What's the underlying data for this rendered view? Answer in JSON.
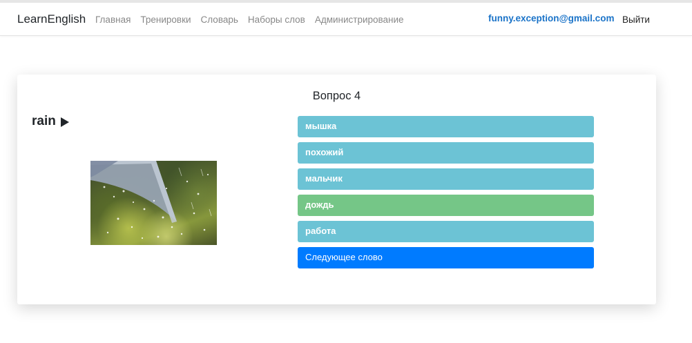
{
  "navbar": {
    "brand": "LearnEnglish",
    "links": [
      "Главная",
      "Тренировки",
      "Словарь",
      "Наборы слов",
      "Администрирование"
    ],
    "user_email": "funny.exception@gmail.com",
    "logout_label": "Выйти"
  },
  "quiz": {
    "question_title": "Вопрос 4",
    "word": "rain",
    "options": [
      {
        "label": "мышка",
        "state": "info"
      },
      {
        "label": "похожий",
        "state": "info"
      },
      {
        "label": "мальчик",
        "state": "info"
      },
      {
        "label": "дождь",
        "state": "correct"
      },
      {
        "label": "работа",
        "state": "info"
      }
    ],
    "next_label": "Следующее слово"
  },
  "colors": {
    "option": "#6cc3d5",
    "correct": "#75c687",
    "primary": "#007bff",
    "link": "#1a73c8"
  },
  "icons": {
    "play": "play-icon"
  }
}
